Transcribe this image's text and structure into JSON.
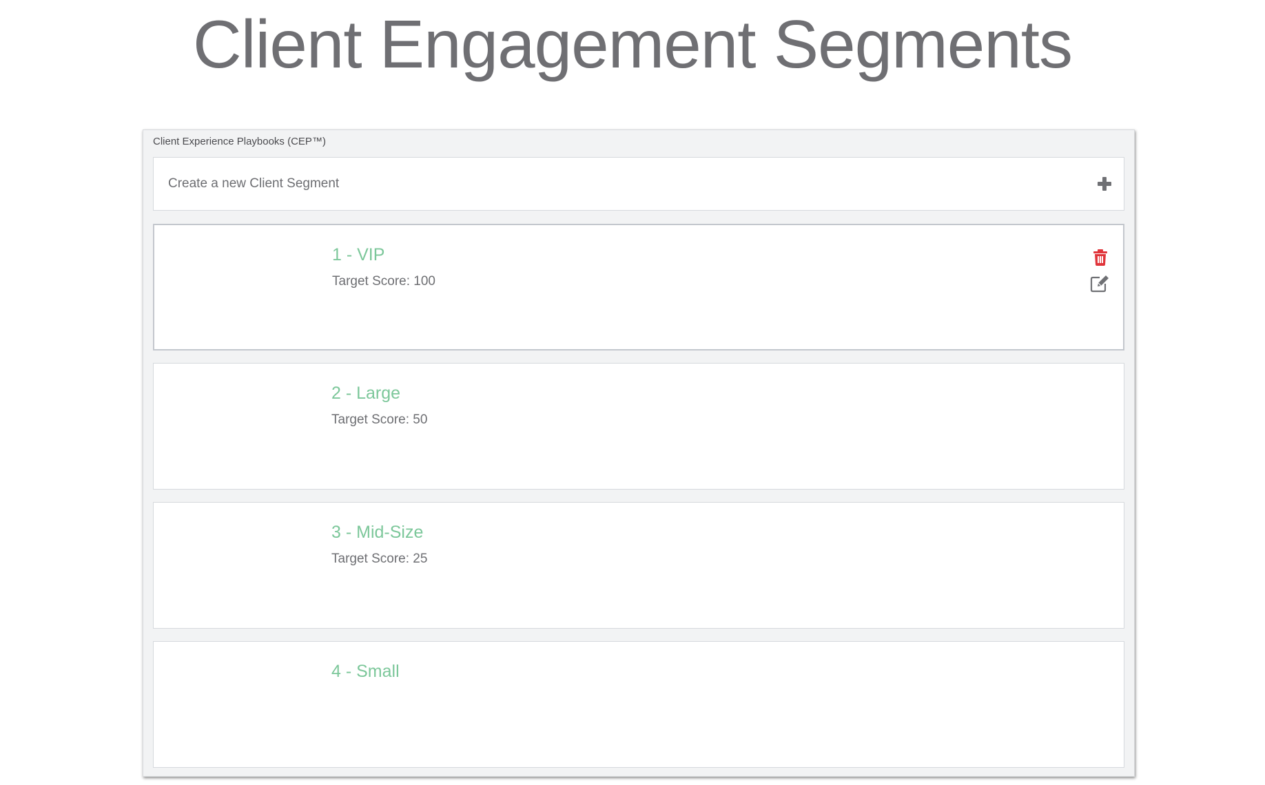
{
  "page": {
    "title": "Client Engagement Segments"
  },
  "panel": {
    "label": "Client Experience Playbooks (CEP™)",
    "new_segment_label": "Create a new Client Segment"
  },
  "segments": [
    {
      "name": "1 - VIP",
      "score_text": "Target Score: 100",
      "selected": true
    },
    {
      "name": "2 - Large",
      "score_text": "Target Score: 50",
      "selected": false
    },
    {
      "name": "3 - Mid-Size",
      "score_text": "Target Score: 25",
      "selected": false
    },
    {
      "name": "4 - Small",
      "score_text": "",
      "selected": false
    }
  ],
  "icons": {
    "add": "plus-icon",
    "delete": "trash-icon",
    "edit": "edit-icon"
  },
  "colors": {
    "title": "#6f6f73",
    "segment_name": "#7cc79a",
    "delete": "#e0353b",
    "panel_bg": "#f2f3f4"
  }
}
